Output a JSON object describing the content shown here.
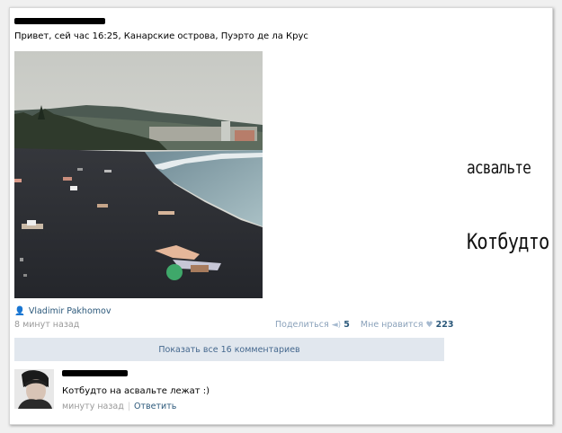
{
  "post": {
    "text": "Привет, сей час 16:25, Канарские острова, Пуэрто де ла Крус",
    "author": "Vladimir Pakhomov",
    "time": "8 минут назад",
    "share_label": "Поделиться",
    "share_count": "5",
    "like_label": "Мне нравится",
    "like_count": "223",
    "share_icon": "megaphone-icon",
    "like_icon": "heart-icon"
  },
  "show_all_comments": "Показать все 16 комментариев",
  "comment": {
    "text": "Котбудто на асвальте лежат :)",
    "time": "минуту назад",
    "reply_label": "Ответить"
  },
  "overlay": {
    "word1": "асвальте",
    "word2": "Котбудто"
  }
}
